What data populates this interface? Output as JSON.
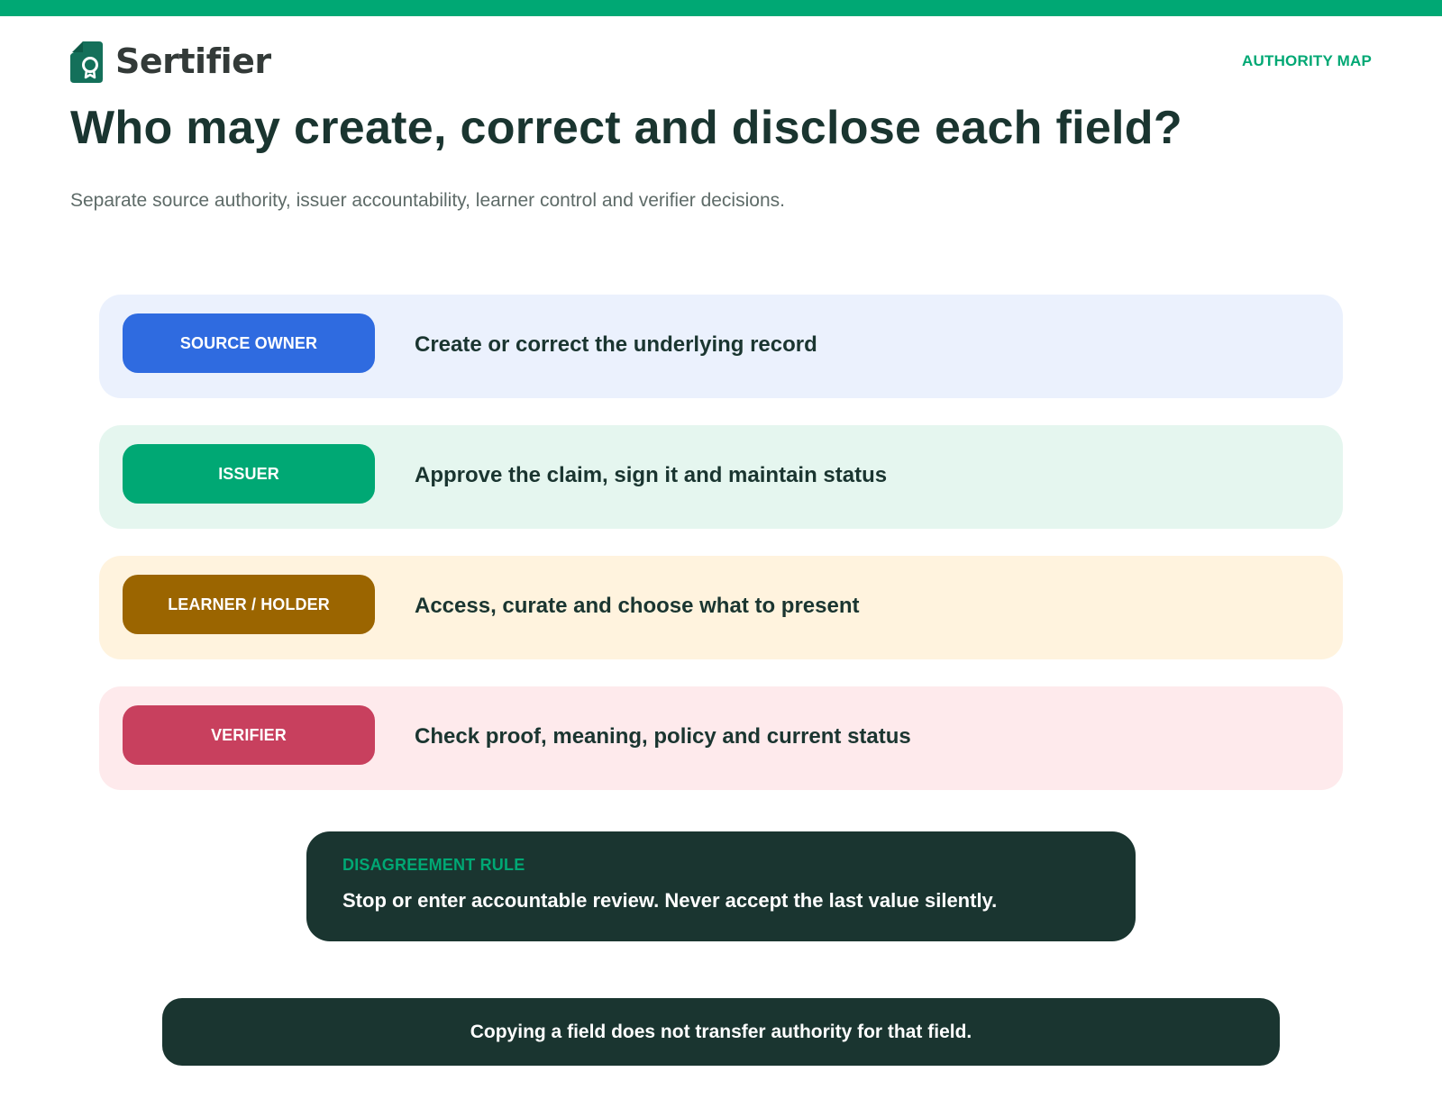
{
  "brand": {
    "name": "Sertifier",
    "logo_icon": "certificate-badge-icon",
    "color": "#00a874"
  },
  "header": {
    "link_label": "AUTHORITY MAP"
  },
  "page": {
    "title": "Who may create, correct and disclose each field?",
    "subtitle": "Separate source authority, issuer accountability, learner control and verifier decisions."
  },
  "roles": [
    {
      "label": "SOURCE OWNER",
      "description": "Create or correct the underlying record",
      "badge_color": "#2f6be0",
      "row_color": "#ebf1fd"
    },
    {
      "label": "ISSUER",
      "description": "Approve the claim, sign it and maintain status",
      "badge_color": "#00a874",
      "row_color": "#e5f6ef"
    },
    {
      "label": "LEARNER / HOLDER",
      "description": "Access, curate and choose what to present",
      "badge_color": "#9b6500",
      "row_color": "#fff3de"
    },
    {
      "label": "VERIFIER",
      "description": "Check proof, meaning, policy and current status",
      "badge_color": "#c8405e",
      "row_color": "#feeaec"
    }
  ],
  "rule": {
    "label": "DISAGREEMENT RULE",
    "text": "Stop or enter accountable review. Never accept the last value silently."
  },
  "footer": {
    "text": "Copying a field does not transfer authority for that field."
  }
}
